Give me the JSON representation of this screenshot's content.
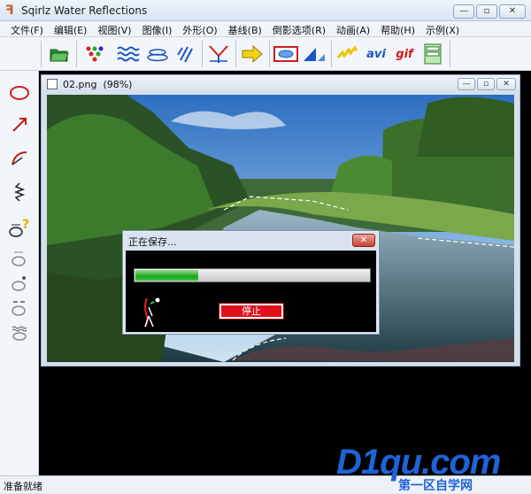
{
  "app": {
    "title": "Sqirlz Water Reflections",
    "icon": "app-logo-icon"
  },
  "window_controls": {
    "minimize": "—",
    "maximize": "▫",
    "close": "✕"
  },
  "menu": [
    {
      "label": "文件(F)"
    },
    {
      "label": "编辑(E)"
    },
    {
      "label": "视图(V)"
    },
    {
      "label": "图像(I)"
    },
    {
      "label": "外形(O)"
    },
    {
      "label": "基线(B)"
    },
    {
      "label": "倒影选项(R)"
    },
    {
      "label": "动画(A)"
    },
    {
      "label": "帮助(H)"
    },
    {
      "label": "示例(X)"
    }
  ],
  "toolbar": {
    "avi_label": "avi",
    "gif_label": "gif"
  },
  "document": {
    "title": "02.png",
    "zoom": "(98%)"
  },
  "dialog": {
    "title": "正在保存...",
    "progress": 0.27,
    "stop_label": "停止",
    "close_glyph": "✕"
  },
  "status": {
    "text": "准备就绪"
  },
  "watermark": {
    "main": "D1qu.com",
    "sub": "第一区自学网"
  },
  "colors": {
    "accent_blue": "#1e63d8",
    "progress_green": "#1fa523",
    "stop_red": "#e0101a"
  }
}
